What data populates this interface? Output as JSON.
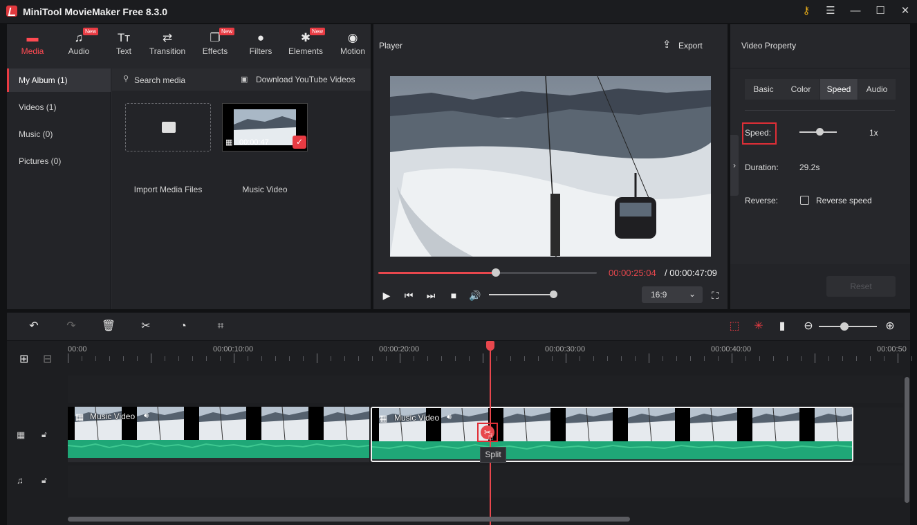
{
  "window": {
    "title": "MiniTool MovieMaker Free 8.3.0"
  },
  "media_tabs": [
    {
      "label": "Media",
      "icon": "folder-icon",
      "badge": ""
    },
    {
      "label": "Audio",
      "icon": "music-note-icon",
      "badge": "New"
    },
    {
      "label": "Text",
      "icon": "text-icon",
      "badge": ""
    },
    {
      "label": "Transition",
      "icon": "transition-arrows-icon",
      "badge": ""
    },
    {
      "label": "Effects",
      "icon": "effects-icon",
      "badge": "New"
    },
    {
      "label": "Filters",
      "icon": "filters-icon",
      "badge": ""
    },
    {
      "label": "Elements",
      "icon": "elements-icon",
      "badge": "New"
    },
    {
      "label": "Motion",
      "icon": "motion-icon",
      "badge": ""
    }
  ],
  "album": [
    {
      "label": "My Album (1)"
    },
    {
      "label": "Videos (1)"
    },
    {
      "label": "Music (0)"
    },
    {
      "label": "Pictures (0)"
    }
  ],
  "search": {
    "label": "Search media",
    "download": "Download YouTube Videos"
  },
  "media_items": {
    "import_label": "Import Media Files",
    "video_label": "Music Video",
    "video_duration": "00:00:47"
  },
  "player": {
    "title": "Player",
    "export": "Export",
    "current_time": "00:00:25:04",
    "total_time": "/ 00:00:47:09",
    "progress": 0.54,
    "volume": 0.97,
    "aspect": "16:9"
  },
  "property": {
    "title": "Video Property",
    "tabs": [
      "Basic",
      "Color",
      "Speed",
      "Audio"
    ],
    "active_tab": "Speed",
    "speed_label": "Speed:",
    "speed_value": "1x",
    "speed_level": 0.5,
    "duration_label": "Duration:",
    "duration_value": "29.2s",
    "reverse_label": "Reverse:",
    "reverse_checkbox": "Reverse speed",
    "reset": "Reset"
  },
  "timeline": {
    "ticks": [
      "00:00",
      "00:00:10:00",
      "00:00:20:00",
      "00:00:30:00",
      "00:00:40:00",
      "00:00:50"
    ],
    "playhead_fraction": 0.502,
    "clip1_label": "Music Video",
    "clip2_label": "Music Video",
    "tooltip": "Split",
    "zoom_level": 0.5
  },
  "colors": {
    "accent": "#e83b43",
    "wave": "#1fa777",
    "panel": "#26272b"
  }
}
